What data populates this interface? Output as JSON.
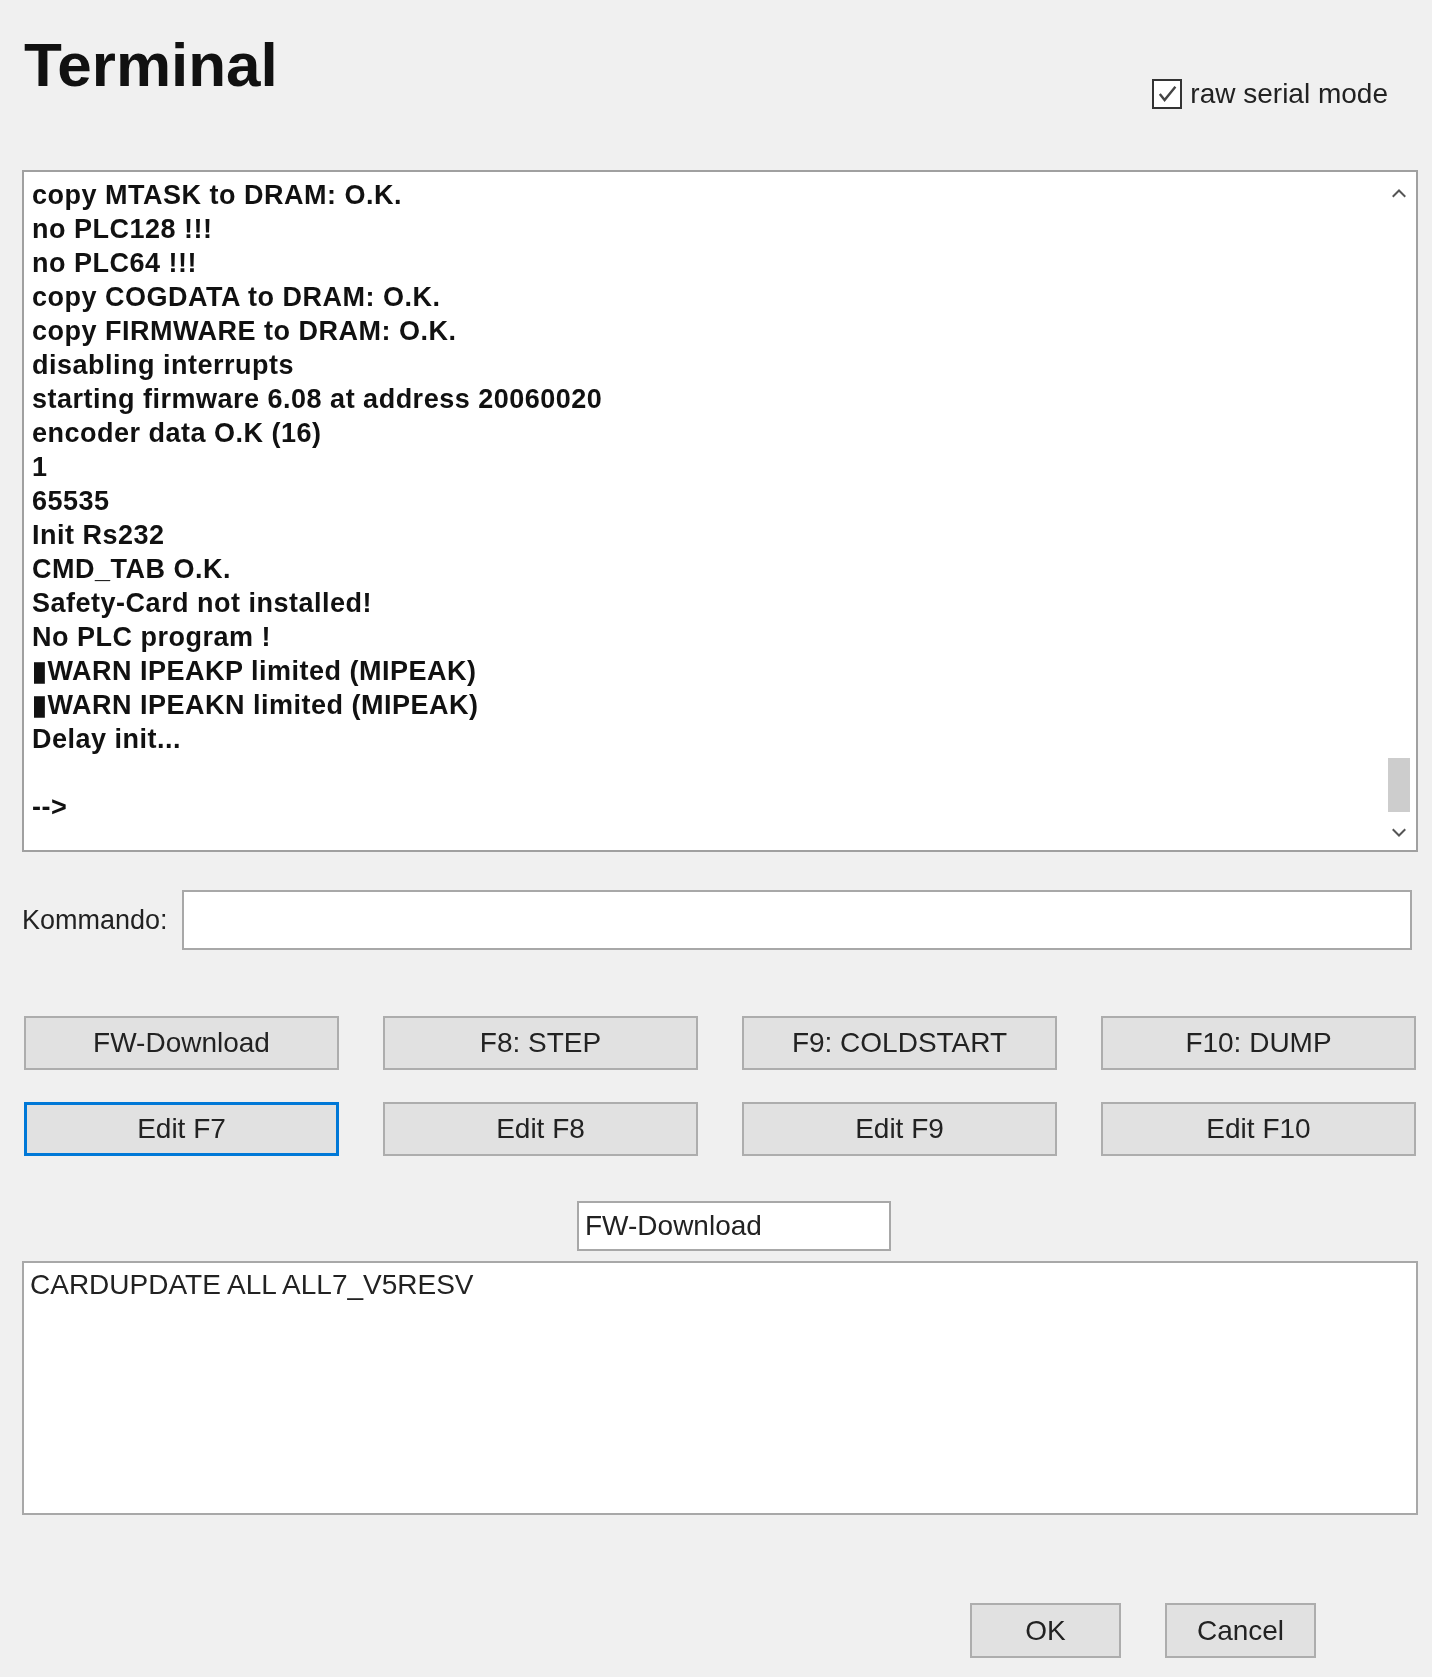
{
  "window": {
    "title": "Terminal"
  },
  "raw_serial_mode": {
    "label": "raw serial mode",
    "checked": true
  },
  "terminal": {
    "lines": [
      "copy MTASK to DRAM: O.K.",
      "no PLC128 !!!",
      "no PLC64 !!!",
      "copy COGDATA to DRAM: O.K.",
      "copy FIRMWARE to DRAM: O.K.",
      "disabling interrupts",
      "starting firmware 6.08 at address 20060020",
      "encoder data O.K (16)",
      "1",
      "65535",
      "Init Rs232",
      "CMD_TAB O.K.",
      "Safety-Card not installed!",
      "No PLC program !",
      "▮WARN IPEAKP limited (MIPEAK)",
      "▮WARN IPEAKN limited (MIPEAK)",
      "Delay init..."
    ],
    "prompt": "-->"
  },
  "command": {
    "label": "Kommando:"
  },
  "function_buttons": [
    {
      "label": "FW-Download",
      "focused": false
    },
    {
      "label": "F8: STEP",
      "focused": false
    },
    {
      "label": "F9: COLDSTART",
      "focused": false
    },
    {
      "label": "F10: DUMP",
      "focused": false
    },
    {
      "label": "Edit F7",
      "focused": true
    },
    {
      "label": "Edit F8",
      "focused": false
    },
    {
      "label": "Edit F9",
      "focused": false
    },
    {
      "label": "Edit F10",
      "focused": false
    }
  ],
  "editor": {
    "name": "FW-Download",
    "content": "CARDUPDATE ALL ALL7_V5RESV"
  },
  "buttons": [
    "OK",
    "Cancel"
  ]
}
